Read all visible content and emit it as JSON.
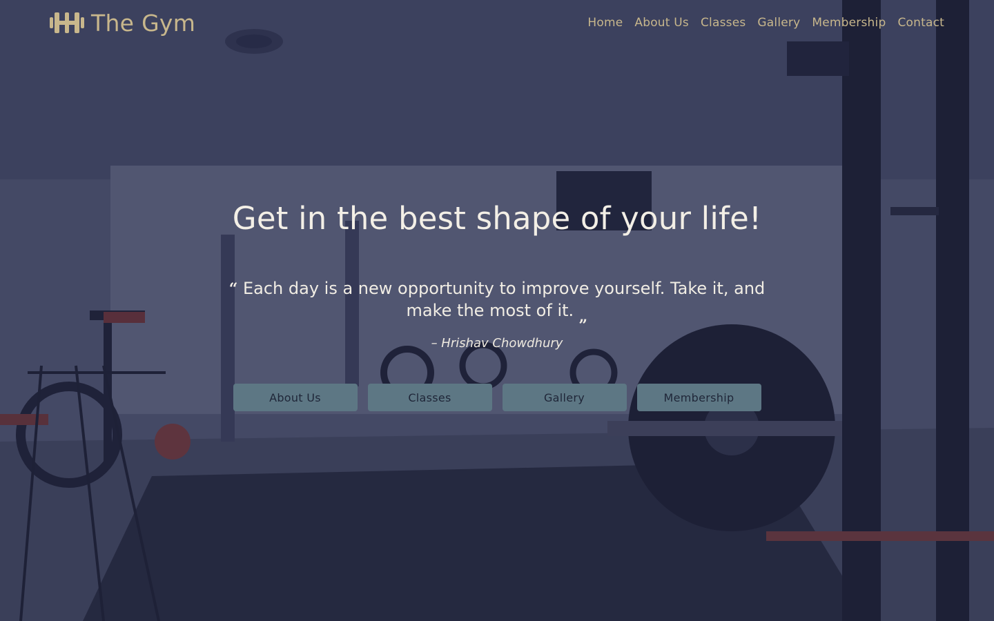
{
  "brand": {
    "name": "The Gym",
    "icon": "dumbbell-icon",
    "color": "#c8b78c"
  },
  "nav": {
    "items": [
      {
        "label": "Home"
      },
      {
        "label": "About Us"
      },
      {
        "label": "Classes"
      },
      {
        "label": "Gallery"
      },
      {
        "label": "Membership"
      },
      {
        "label": "Contact"
      }
    ]
  },
  "hero": {
    "title": "Get in the best shape of your life!",
    "quote": {
      "open_mark": "“",
      "text": "Each day is a new opportunity to improve yourself. Take it, and make the most of it.",
      "close_mark": "„",
      "author": "– Hrishav Chowdhury"
    },
    "buttons": [
      {
        "label": "About Us"
      },
      {
        "label": "Classes"
      },
      {
        "label": "Gallery"
      },
      {
        "label": "Membership"
      }
    ]
  },
  "colors": {
    "accent": "#c8b78c",
    "button_bg": "#5d7784",
    "overlay": "#202440"
  }
}
